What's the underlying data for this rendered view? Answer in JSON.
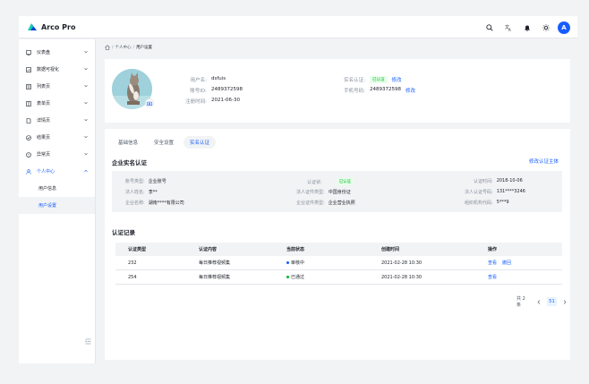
{
  "app": {
    "title": "Arco Pro",
    "user_initial": "A"
  },
  "header": {
    "icons": [
      "search-icon",
      "language-icon",
      "notification-icon",
      "theme-icon"
    ]
  },
  "sidebar": {
    "items": [
      {
        "label": "仪表盘",
        "icon": "dashboard-icon"
      },
      {
        "label": "数据可视化",
        "icon": "chart-icon"
      },
      {
        "label": "列表页",
        "icon": "list-icon"
      },
      {
        "label": "表单页",
        "icon": "form-icon"
      },
      {
        "label": "详情页",
        "icon": "detail-icon"
      },
      {
        "label": "结果页",
        "icon": "result-icon"
      },
      {
        "label": "异常页",
        "icon": "exception-icon"
      },
      {
        "label": "个人中心",
        "icon": "user-icon"
      }
    ],
    "submenu": [
      {
        "label": "用户信息"
      },
      {
        "label": "用户设置"
      }
    ]
  },
  "breadcrumb": {
    "part1": "个人中心",
    "part2": "用户设置"
  },
  "profile": {
    "username_label": "用户名:",
    "username": "dsfuis",
    "account_label": "账号ID:",
    "account_id": "2489372598",
    "reg_label": "注册时间:",
    "reg_date": "2021-06-30",
    "verify_label": "实名认证:",
    "verify_badge": "已认证",
    "verify_edit": "修改",
    "phone_label": "手机号码:",
    "phone": "2489372598",
    "phone_edit": "修改"
  },
  "tabs": [
    "基础信息",
    "安全设置",
    "实名认证"
  ],
  "enterprise": {
    "title": "企业实名认证",
    "modify_link": "修改认证主体",
    "fields": {
      "acct_type_label": "账号类型:",
      "acct_type": "企业账号",
      "status_label": "认证状:",
      "status": "已认证",
      "time_label": "认证时间:",
      "time": "2018-10-06",
      "legal_label": "法人姓名:",
      "legal": "李**",
      "legal_id_type_label": "法人证件类型:",
      "legal_id_type": "中国身份证",
      "legal_id_label": "法人认证号码:",
      "legal_id": "131****3246",
      "company_label": "企业名称:",
      "company": "湖南****有限公司",
      "company_id_type_label": "企业证件类型:",
      "company_id_type": "企业营业执照",
      "org_code_label": "组织机构代码:",
      "org_code": "5***9"
    }
  },
  "records": {
    "title": "认证记录",
    "headers": [
      "认证类型",
      "认证内容",
      "当前状态",
      "创建时间",
      "操作"
    ],
    "rows": [
      {
        "type": "232",
        "content": "每日推荐视频集",
        "status": "审核中",
        "status_color": "#165dff",
        "time": "2021-02-28 10:30",
        "actions": [
          "查看",
          "撤回"
        ]
      },
      {
        "type": "254",
        "content": "每日推荐视频集",
        "status": "已通过",
        "status_color": "#00b42a",
        "time": "2021-02-28 10:30",
        "actions": [
          "查看"
        ]
      }
    ]
  },
  "pager": {
    "total": "共 2 条",
    "current": "51"
  },
  "colors": {
    "primary": "#165dff",
    "success": "#00b42a"
  }
}
